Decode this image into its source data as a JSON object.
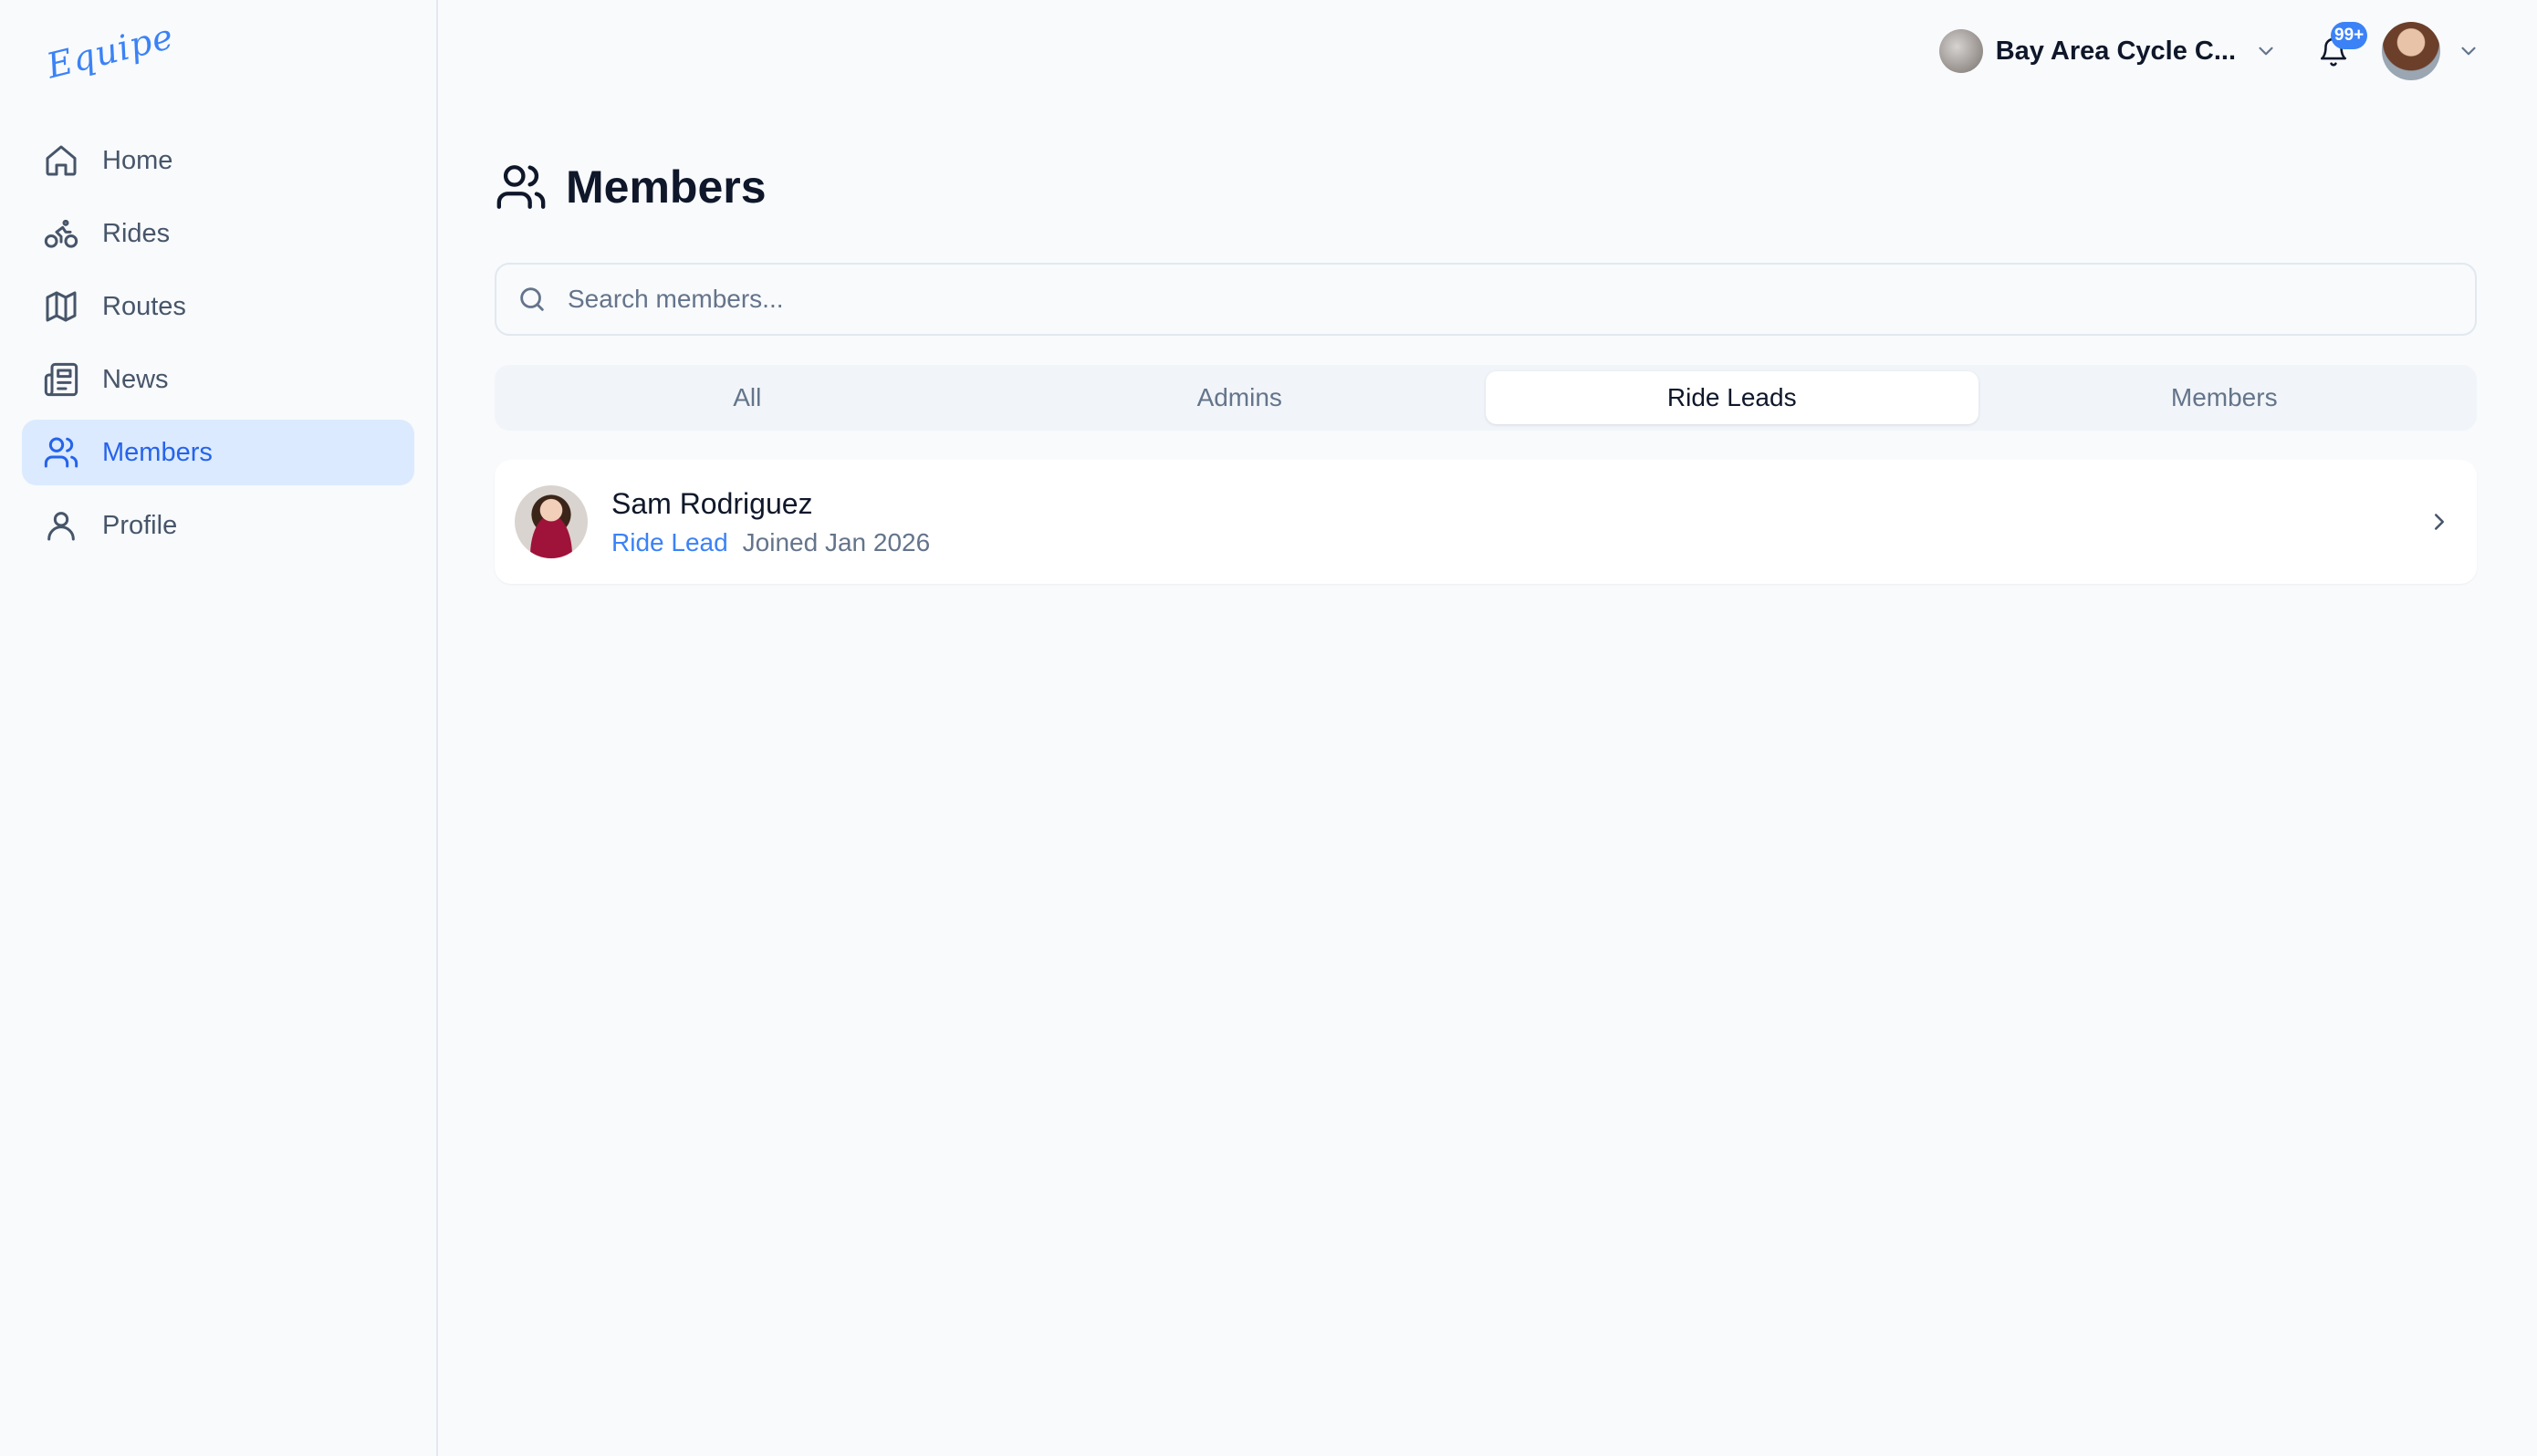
{
  "app": {
    "logo_text": "Equipe"
  },
  "sidebar": {
    "items": [
      {
        "label": "Home",
        "icon": "home-icon",
        "active": false
      },
      {
        "label": "Rides",
        "icon": "bike-icon",
        "active": false
      },
      {
        "label": "Routes",
        "icon": "map-icon",
        "active": false
      },
      {
        "label": "News",
        "icon": "newspaper-icon",
        "active": false
      },
      {
        "label": "Members",
        "icon": "users-icon",
        "active": true
      },
      {
        "label": "Profile",
        "icon": "user-icon",
        "active": false
      }
    ]
  },
  "header": {
    "club_name": "Bay Area Cycle C...",
    "notification_count": "99+"
  },
  "page": {
    "title": "Members",
    "search_placeholder": "Search members...",
    "search_value": ""
  },
  "tabs": [
    {
      "label": "All",
      "active": false
    },
    {
      "label": "Admins",
      "active": false
    },
    {
      "label": "Ride Leads",
      "active": true
    },
    {
      "label": "Members",
      "active": false
    }
  ],
  "members": [
    {
      "name": "Sam Rodriguez",
      "role": "Ride Lead",
      "joined": "Joined Jan 2026"
    }
  ],
  "colors": {
    "accent": "#3b82f6",
    "active_nav_bg": "#dbeafe",
    "background": "#f8fafc"
  }
}
